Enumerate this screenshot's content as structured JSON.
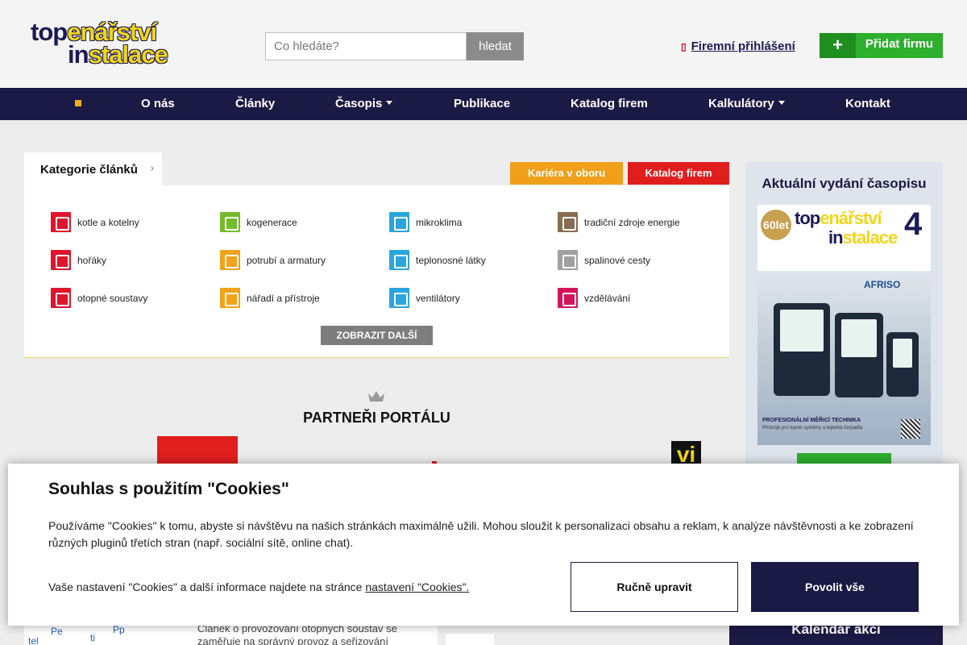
{
  "header": {
    "logo": {
      "line1_navy": "top",
      "line1_yellow": "enářství",
      "line2_navy": "in",
      "line2_yellow": "stalace"
    },
    "search": {
      "placeholder": "Co hledáte?",
      "button": "hledat"
    },
    "login_label": "Firemní přihlášení",
    "add_firm": {
      "plus": "+",
      "label": "Přidat firmu"
    },
    "colors": {
      "navy": "#1b1a55",
      "yellow": "#f2d51b",
      "green": "#2eaf2e"
    }
  },
  "nav": {
    "items": [
      {
        "label": "",
        "icon": "home-icon"
      },
      {
        "label": "O nás"
      },
      {
        "label": "Články"
      },
      {
        "label": "Časopis",
        "dropdown": true
      },
      {
        "label": "Publikace"
      },
      {
        "label": "Katalog firem"
      },
      {
        "label": "Kalkulátory",
        "dropdown": true
      },
      {
        "label": "Kontakt"
      }
    ]
  },
  "categories": {
    "tab_label": "Kategorie článků",
    "career_button": "Kariéra v oboru",
    "catalog_button": "Katalog firem",
    "items": [
      {
        "label": "kotle a kotelny",
        "color": "#e0142b"
      },
      {
        "label": "kogenerace",
        "color": "#74bb2c"
      },
      {
        "label": "mikroklima",
        "color": "#2aa6dd"
      },
      {
        "label": "tradiční zdroje energie",
        "color": "#8a6c4e"
      },
      {
        "label": "hořáky",
        "color": "#e0142b"
      },
      {
        "label": "potrubí a armatury",
        "color": "#f2a21b"
      },
      {
        "label": "teplonosné látky",
        "color": "#2aa6dd"
      },
      {
        "label": "spalinové cesty",
        "color": "#a0a0a0"
      },
      {
        "label": "otopné soustavy",
        "color": "#e0142b"
      },
      {
        "label": "nářadí a přístroje",
        "color": "#f2a21b"
      },
      {
        "label": "ventilátory",
        "color": "#2aa6dd"
      },
      {
        "label": "vzdělávání",
        "color": "#d4145a"
      }
    ],
    "more_button": "ZOBRAZIT DALŠÍ"
  },
  "partners": {
    "title": "PARTNEŘI PORTÁLU",
    "prev": "‹",
    "next": "›",
    "logo_text": "vi"
  },
  "sidebar": {
    "title": "Aktuální vydání časopisu",
    "magazine": {
      "badge": "60let",
      "logo1_navy": "top",
      "logo1_yellow": "enářství",
      "logo2_navy": "in",
      "logo2_yellow": "stalace",
      "issue": "4",
      "brand": "AFRISO",
      "caption": "PROFESIONÁLNÍ MĚŘICÍ TECHNIKA",
      "caption2": "Přístroje pro topné systémy a tepelná čerpadla"
    }
  },
  "article": {
    "text": "Článek o provozování otopných soustav se zaměřuje na správný provoz a seřizování",
    "diagram_labels": [
      "Pe",
      "tel",
      "ti",
      "Pp"
    ]
  },
  "calendar_label": "Kalendář akcí",
  "cookie": {
    "title": "Souhlas s použitím \"Cookies\"",
    "text": "Používáme \"Cookies\" k tomu, abyste si návštěvu na našich stránkách maximálně užili. Mohou sloužit k personalizaci obsahu a reklam, k analýze návštěvnosti a ke zobrazení různých pluginů třetích stran (např. sociální sítě, online chat).",
    "settings_text": "Vaše nastavení \"Cookies\" a další informace najdete na stránce",
    "settings_link": "nastavení \"Cookies\".",
    "manual_button": "Ručně upravit",
    "allow_button": "Povolit vše"
  }
}
